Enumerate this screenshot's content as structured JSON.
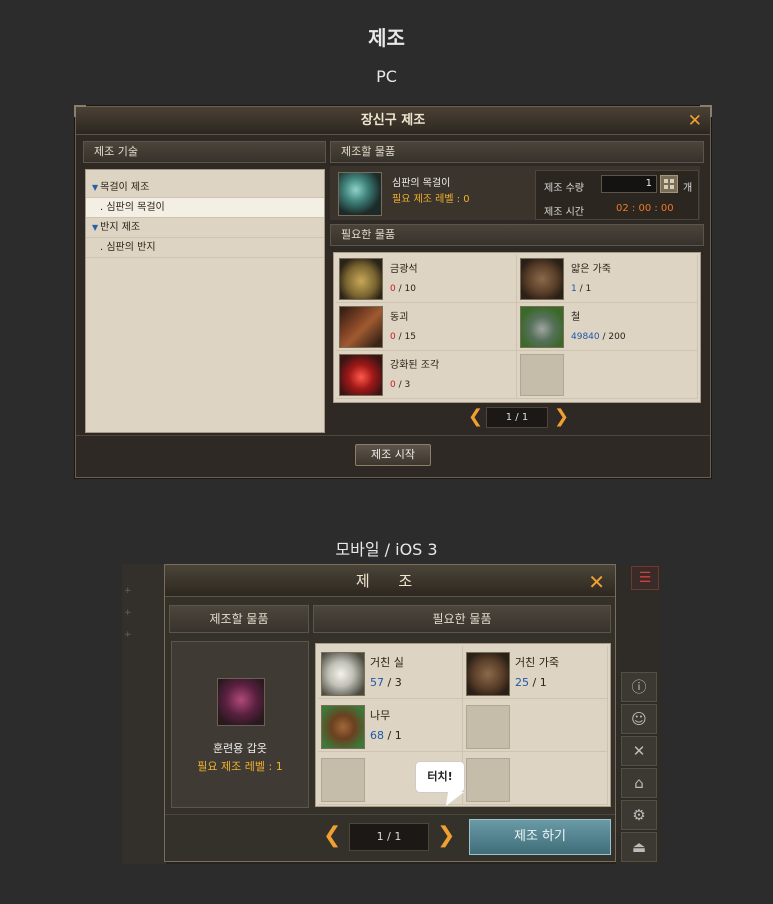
{
  "page": {
    "title": "제조",
    "pc_label": "PC",
    "mobile_label": "모바일 / iOS 3"
  },
  "pc": {
    "window_title": "장신구 제조",
    "close": "✕",
    "left_header": "제조 기술",
    "tree": [
      {
        "label": "목걸이 제조",
        "kind": "category"
      },
      {
        "label": ". 심판의 목걸이",
        "kind": "item",
        "selected": true
      },
      {
        "label": "반지 제조",
        "kind": "category"
      },
      {
        "label": ". 심판의 반지",
        "kind": "item"
      }
    ],
    "target_header": "제조할 물품",
    "target_item": {
      "name": "심판의 목걸이",
      "level": "필요 제조 레벨 : 0",
      "icon": "necklace-icon"
    },
    "quantity": {
      "label": "제조 수량",
      "value": "1",
      "unit": "개"
    },
    "time": {
      "label": "제조 시간",
      "value": "02 : 00 : 00"
    },
    "materials_header": "필요한 물품",
    "materials": [
      {
        "name": "금광석",
        "have": "0",
        "need": "/ 10",
        "status": "red",
        "icon": "ore-icon"
      },
      {
        "name": "얇은 가죽",
        "have": "1",
        "need": "/ 1",
        "status": "blue",
        "icon": "leather-icon"
      },
      {
        "name": "동괴",
        "have": "0",
        "need": "/ 15",
        "status": "red",
        "icon": "copper-ingot-icon"
      },
      {
        "name": "철",
        "have": "49840",
        "need": "/ 200",
        "status": "blue",
        "icon": "iron-icon"
      },
      {
        "name": "강화된 조각",
        "have": "0",
        "need": "/ 3",
        "status": "red",
        "icon": "shard-icon"
      }
    ],
    "page_indicator": "1 / 1",
    "start_button": "제조 시작",
    "accent_colors": {
      "orange": "#f0a030",
      "red": "#c02020",
      "blue": "#1f57a6"
    }
  },
  "mobile": {
    "window_title": "제 조",
    "close": "✕",
    "target_header": "제조할 물품",
    "materials_header": "필요한 물품",
    "target_item": {
      "name": "훈련용 갑옷",
      "level": "필요 제조 레벨 : 1",
      "icon": "armor-icon"
    },
    "materials": [
      {
        "name": "거친 실",
        "have": "57",
        "need": "/ 3",
        "status": "blue",
        "icon": "thread-icon"
      },
      {
        "name": "거친 가죽",
        "have": "25",
        "need": "/ 1",
        "status": "blue",
        "icon": "leather-icon"
      },
      {
        "name": "나무",
        "have": "68",
        "need": "/ 1",
        "status": "blue",
        "icon": "wood-icon"
      }
    ],
    "page_indicator": "1 / 1",
    "craft_button": "제조 하기",
    "tooltip": "터치!",
    "side_icons": [
      "info-icon",
      "party-icon",
      "crossed-swords-icon",
      "home-icon",
      "gear-icon",
      "eject-icon"
    ]
  }
}
